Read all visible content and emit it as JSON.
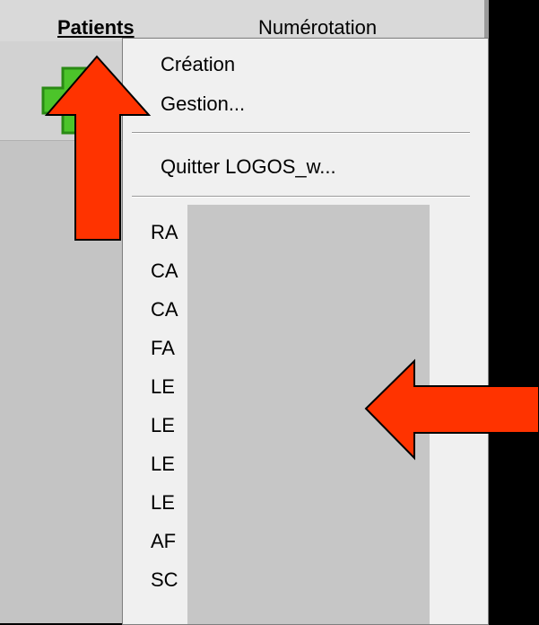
{
  "menubar": {
    "patients_label": "Patients",
    "numeration_label": "Numérotation"
  },
  "toolbar": {
    "add_icon": "green-plus-icon"
  },
  "dropdown": {
    "creation_label": "Création",
    "gestion_label": "Gestion...",
    "quitter_label": "Quitter LOGOS_w...",
    "recent_patients": [
      "RA",
      "CA",
      "CA",
      "FA",
      "LE",
      "LE",
      "LE",
      "LE",
      "AF",
      "SC"
    ]
  },
  "annotations": {
    "arrow_color": "#ff3300",
    "arrow_up_icon": "red-arrow-up-icon",
    "arrow_left_icon": "red-arrow-left-icon"
  },
  "colors": {
    "plus_green": "#4cc42a",
    "menu_bg": "#f0f0f0",
    "redact_gray": "#c6c6c6"
  }
}
